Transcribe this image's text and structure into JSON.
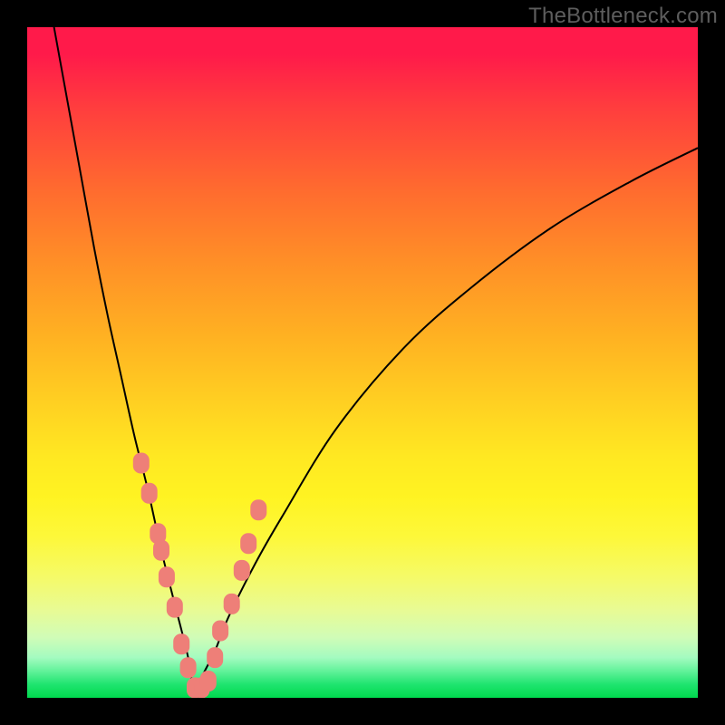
{
  "branding": {
    "watermark": "TheBottleneck.com"
  },
  "colors": {
    "curve_stroke": "#000000",
    "marker_fill": "#ee7f78",
    "marker_stroke": "#ee7f78"
  },
  "chart_data": {
    "type": "line",
    "title": "",
    "xlabel": "",
    "ylabel": "",
    "xlim": [
      0,
      100
    ],
    "ylim": [
      0,
      100
    ],
    "grid": false,
    "legend": false,
    "note": "V-shaped bottleneck curve. X is normalized hardware balance position (0–100); Y is normalized bottleneck percentage (0–100). Curve minimum ≈ x 25. Values estimated from pixel positions against the plot area.",
    "series": [
      {
        "name": "bottleneck-curve",
        "x": [
          4,
          6,
          8,
          10,
          12,
          14,
          16,
          18,
          20,
          22,
          24,
          25,
          26,
          28,
          30,
          34,
          38,
          46,
          56,
          66,
          78,
          90,
          100
        ],
        "y": [
          100,
          89,
          78,
          67,
          57,
          48,
          39,
          31,
          22,
          14,
          6,
          0,
          3,
          7,
          12,
          20,
          27,
          40,
          52,
          61,
          70,
          77,
          82
        ]
      }
    ],
    "markers": {
      "name": "highlighted-points",
      "shape": "rounded-rect",
      "x": [
        17.0,
        18.2,
        19.5,
        20.0,
        20.8,
        22.0,
        23.0,
        24.0,
        25.0,
        26.0,
        27.0,
        28.0,
        28.8,
        30.5,
        32.0,
        33.0,
        34.5
      ],
      "y": [
        35.0,
        30.5,
        24.5,
        22.0,
        18.0,
        13.5,
        8.0,
        4.5,
        1.5,
        1.5,
        2.5,
        6.0,
        10.0,
        14.0,
        19.0,
        23.0,
        28.0
      ]
    }
  }
}
